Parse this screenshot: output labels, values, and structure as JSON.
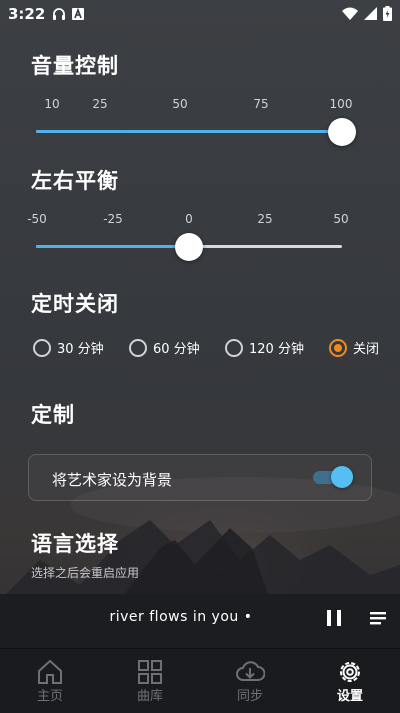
{
  "status_bar": {
    "time": "3:22",
    "left_icons": [
      "headphones-icon",
      "a-badge-icon"
    ],
    "right_icons": [
      "wifi-icon",
      "signal-icon",
      "battery-icon"
    ]
  },
  "volume": {
    "title": "音量控制",
    "ticks": [
      "10",
      "25",
      "50",
      "75",
      "100"
    ],
    "value": 100
  },
  "balance": {
    "title": "左右平衡",
    "ticks": [
      "-50",
      "-25",
      "0",
      "25",
      "50"
    ],
    "value": 0
  },
  "sleep_timer": {
    "title": "定时关闭",
    "options": [
      "30 分钟",
      "60 分钟",
      "120 分钟",
      "关闭"
    ],
    "selected": "关闭"
  },
  "customize": {
    "title": "定制",
    "artist_bg_label": "将艺术家设为背景",
    "artist_bg_enabled": true
  },
  "language": {
    "title": "语言选择",
    "subtitle": "选择之后会重启应用"
  },
  "player": {
    "song": "river  flows  in  you •",
    "state": "playing"
  },
  "nav": {
    "items": [
      {
        "label": "主页",
        "icon": "home-icon"
      },
      {
        "label": "曲库",
        "icon": "library-grid-icon"
      },
      {
        "label": "同步",
        "icon": "cloud-download-icon"
      },
      {
        "label": "设置",
        "icon": "gear-icon"
      }
    ],
    "active": "设置"
  },
  "colors": {
    "accent_blue": "#4fb3ea",
    "accent_orange": "#f28a1b"
  }
}
